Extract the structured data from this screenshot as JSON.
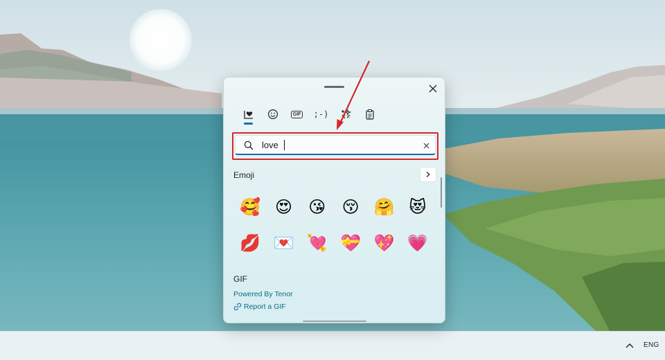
{
  "emoji_panel": {
    "tabs": [
      {
        "id": "recent",
        "icon": "heart-box-icon",
        "active": true
      },
      {
        "id": "emoji",
        "icon": "smiley-icon",
        "active": false
      },
      {
        "id": "gif",
        "icon": "gif-icon",
        "label": "GIF",
        "active": false
      },
      {
        "id": "kaomoji",
        "icon": "kaomoji-icon",
        "label": ";-)",
        "active": false
      },
      {
        "id": "symbols",
        "icon": "symbols-icon",
        "active": false
      },
      {
        "id": "clipboard",
        "icon": "clipboard-icon",
        "active": false
      }
    ],
    "search": {
      "value": "love"
    },
    "emoji_section": {
      "title": "Emoji",
      "rows": [
        [
          "🥰",
          "😍",
          "😘",
          "😚",
          "🤗",
          "😻"
        ],
        [
          "💋",
          "💌",
          "💘",
          "💝",
          "💖",
          "💗"
        ]
      ]
    },
    "gif_section": {
      "title": "GIF",
      "powered_by": "Powered By Tenor",
      "report_link": "Report a GIF"
    }
  },
  "taskbar": {
    "language": "ENG"
  },
  "colors": {
    "accent": "#0f6cbd",
    "highlight_box": "#d62728",
    "link": "#0f6b86"
  }
}
